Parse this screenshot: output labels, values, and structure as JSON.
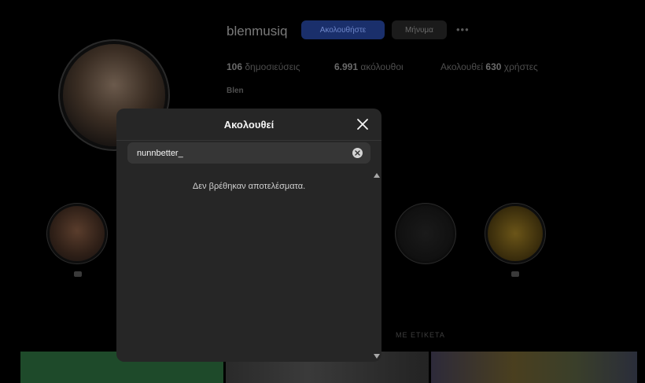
{
  "profile": {
    "username": "blenmusiq",
    "follow_label": "Ακολουθήστε",
    "message_label": "Μήνυμα",
    "more_label": "•••",
    "posts_count": "106",
    "posts_label": "δημοσιεύσεις",
    "followers_count": "6.991",
    "followers_label": "ακόλουθοι",
    "following_prefix": "Ακολουθεί",
    "following_count": "630",
    "following_suffix": "χρήστες",
    "display_name": "Blen",
    "tagged_label": "ΜΕ ΕΤΙΚΕΤΑ"
  },
  "modal": {
    "title": "Ακολουθεί",
    "search_value": "nunnbetter_",
    "empty_message": "Δεν βρέθηκαν αποτελέσματα."
  },
  "colors": {
    "modal_bg": "#262626",
    "search_bg": "#363636",
    "follow_btn": "#1a2f6b"
  }
}
